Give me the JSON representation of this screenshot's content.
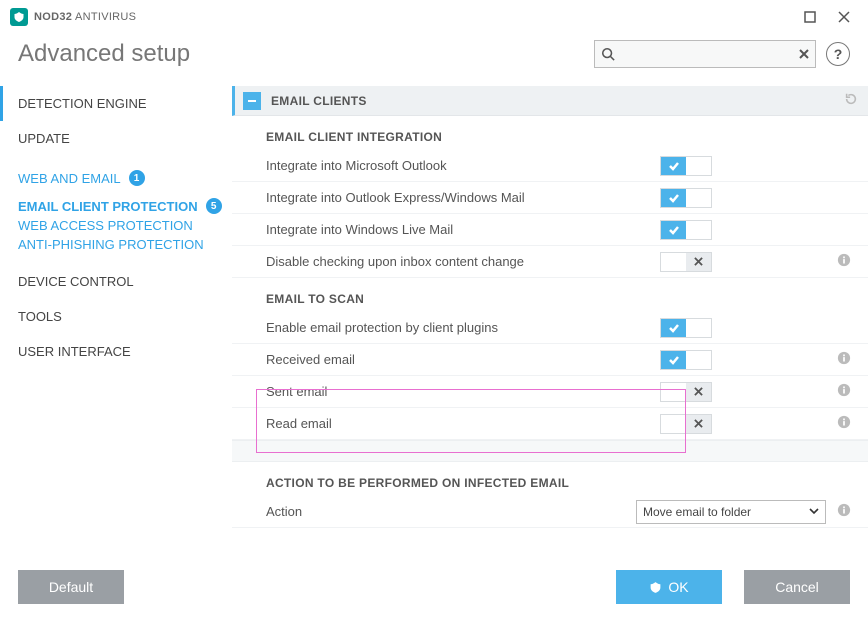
{
  "app": {
    "brand1": "NOD32",
    "brand2": "ANTIVIRUS"
  },
  "header": {
    "title": "Advanced setup",
    "search_placeholder": ""
  },
  "sidebar": {
    "items": [
      {
        "label": "DETECTION ENGINE"
      },
      {
        "label": "UPDATE"
      },
      {
        "label": "WEB AND EMAIL",
        "badge": "1"
      },
      {
        "label": "DEVICE CONTROL"
      },
      {
        "label": "TOOLS"
      },
      {
        "label": "USER INTERFACE"
      }
    ],
    "web_sub": {
      "current": "Email client protection",
      "current_badge": "5",
      "others": [
        "Web access protection",
        "Anti-Phishing protection"
      ]
    }
  },
  "content": {
    "main_head": "EMAIL CLIENTS",
    "section1": {
      "head": "EMAIL CLIENT INTEGRATION",
      "rows": [
        {
          "label": "Integrate into Microsoft Outlook",
          "on": true,
          "info": false
        },
        {
          "label": "Integrate into Outlook Express/Windows Mail",
          "on": true,
          "info": false
        },
        {
          "label": "Integrate into Windows Live Mail",
          "on": true,
          "info": false
        },
        {
          "label": "Disable checking upon inbox content change",
          "on": false,
          "info": true
        }
      ]
    },
    "section2": {
      "head": "EMAIL TO SCAN",
      "rows": [
        {
          "label": "Enable email protection by client plugins",
          "on": true,
          "info": false
        },
        {
          "label": "Received email",
          "on": true,
          "info": true
        },
        {
          "label": "Sent email",
          "on": false,
          "info": true
        },
        {
          "label": "Read email",
          "on": false,
          "info": true
        }
      ]
    },
    "section3": {
      "head": "ACTION TO BE PERFORMED ON INFECTED EMAIL",
      "action_label": "Action",
      "action_value": "Move email to folder"
    }
  },
  "footer": {
    "default": "Default",
    "ok": "OK",
    "cancel": "Cancel"
  }
}
